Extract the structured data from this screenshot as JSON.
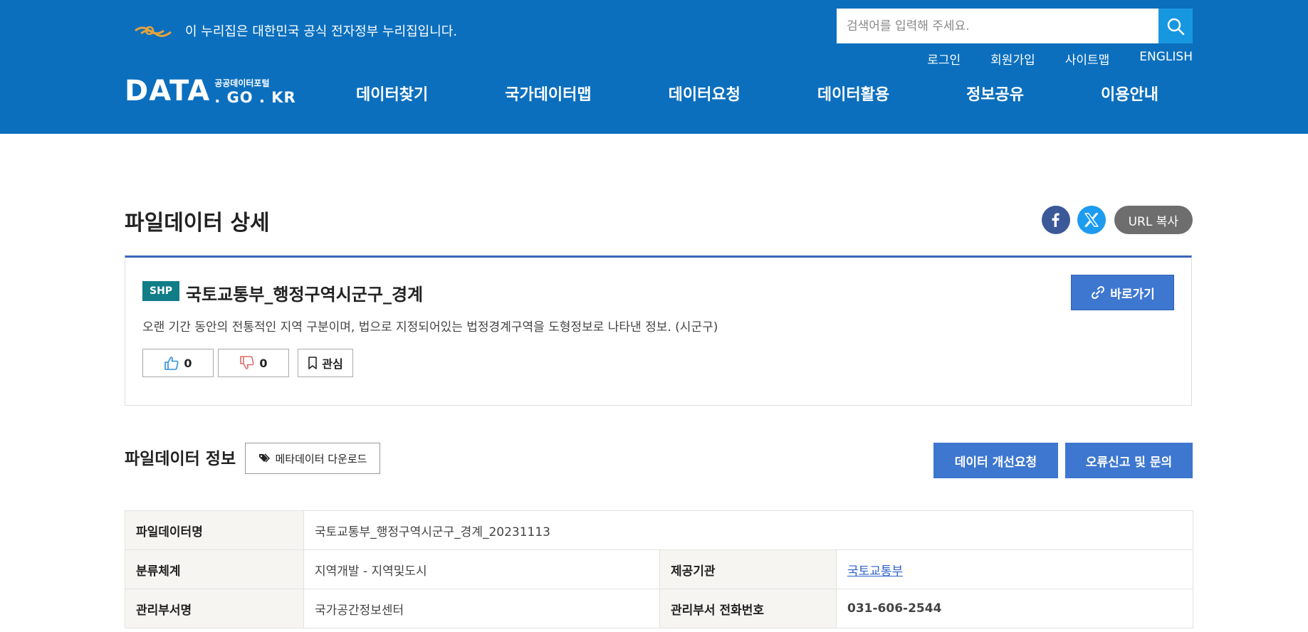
{
  "gov_banner": {
    "icon": "gov-emblem-icon",
    "text": "이 누리집은 대한민국 공식 전자정부 누리집입니다."
  },
  "search": {
    "placeholder": "검색어를 입력해 주세요.",
    "value": "",
    "icon": "search-icon"
  },
  "util_links": [
    "로그인",
    "회원가입",
    "사이트맵",
    "ENGLISH"
  ],
  "brand": {
    "main": "DATA",
    "portal": "공공데이터포털",
    "domain": ". GO . KR"
  },
  "nav": [
    {
      "label": "데이터찾기"
    },
    {
      "label": "국가데이터맵"
    },
    {
      "label": "데이터요청"
    },
    {
      "label": "데이터활용"
    },
    {
      "label": "정보공유"
    },
    {
      "label": "이용안내"
    }
  ],
  "page_title": "파일데이터 상세",
  "share": {
    "facebook_icon": "facebook-icon",
    "x_icon": "x-twitter-icon",
    "url_copy_label": "URL 복사"
  },
  "dataset": {
    "badge": "SHP",
    "title": "국토교통부_행정구역시군구_경계",
    "goto_label": "바로가기",
    "description": "오랜 기간 동안의 전통적인 지역 구분이며, 법으로 지정되어있는 법정경계구역을 도형정보로 나타낸 정보. (시군구)",
    "likes": "0",
    "dislikes": "0",
    "bookmark_label": "관심"
  },
  "file_info": {
    "title": "파일데이터 정보",
    "meta_download_label": "메타데이터 다운로드",
    "improve_request_label": "데이터 개선요청",
    "error_report_label": "오류신고 및 문의"
  },
  "table": {
    "file_name_label": "파일데이터명",
    "file_name_value": "국토교통부_행정구역시군구_경계_20231113",
    "category_label": "분류체계",
    "category_value": "지역개발 - 지역및도시",
    "provider_label": "제공기관",
    "provider_value": "국토교통부",
    "dept_label": "관리부서명",
    "dept_value": "국가공간정보센터",
    "phone_label": "관리부서 전화번호",
    "phone_value": "031-606-2544"
  },
  "colors": {
    "header_bg": "#0b6fbe",
    "primary_button": "#3d77d0",
    "badge": "#117d87",
    "accent_line": "#3a64b7"
  }
}
